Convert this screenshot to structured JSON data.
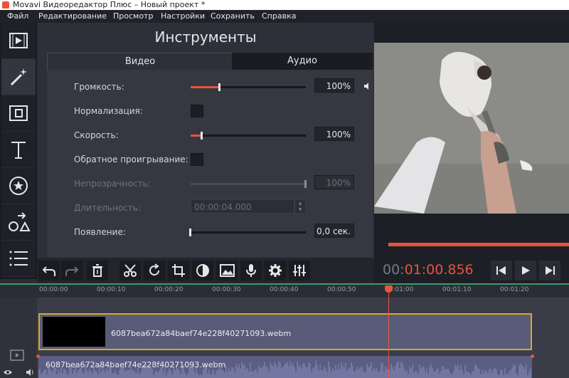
{
  "window": {
    "title": "Movavi Видеоредактор Плюс – Новый проект *"
  },
  "menu": [
    "Файл",
    "Редактирование",
    "Просмотр",
    "Настройки",
    "Сохранить",
    "Справка"
  ],
  "tools": {
    "title": "Инструменты",
    "tabs": {
      "video": "Видео",
      "audio": "Аудио"
    },
    "volume": {
      "label": "Громкость:",
      "value": "100%",
      "level": 0.25
    },
    "normalize": {
      "label": "Нормализация:"
    },
    "speed": {
      "label": "Скорость:",
      "value": "100%",
      "level": 0.1
    },
    "reverse": {
      "label": "Обратное проигрывание:"
    },
    "opacity": {
      "label": "Непрозрачность:",
      "value": "100%",
      "level": 1.0
    },
    "duration": {
      "label": "Длительность:",
      "value": "00:00:04.000"
    },
    "fadein": {
      "label": "Появление:",
      "value": "0,0 сек.",
      "level": 0.0
    }
  },
  "player": {
    "timecode_dim": "00:",
    "timecode_hot": "01:00.856"
  },
  "timeline": {
    "ticks": [
      "00:00:00",
      "00:00:10",
      "00:00:20",
      "00:00:30",
      "00:00:40",
      "00:00:50",
      "00:01:00",
      "00:01:10",
      "00:01:20"
    ],
    "video_clip": "6087bea672a84baef74e228f40271093.webm",
    "audio_clip": "6087bea672a84baef74e228f40271093.webm"
  },
  "colors": {
    "accent": "#e8543a",
    "clip_border": "#d8a82a"
  }
}
